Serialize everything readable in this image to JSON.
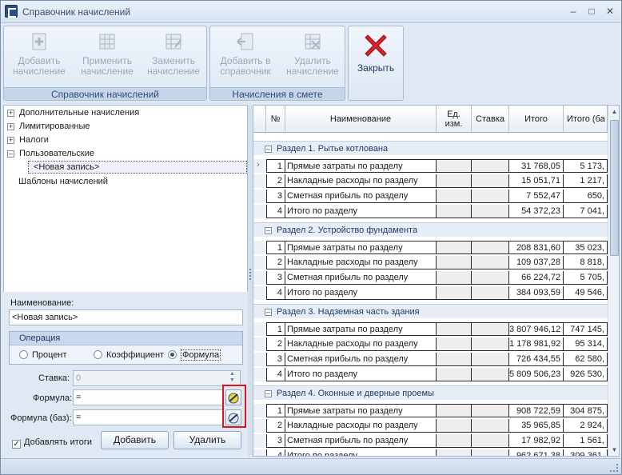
{
  "window": {
    "title": "Справочник начислений"
  },
  "ribbon": {
    "group1": {
      "caption": "Справочник начислений",
      "buttons": [
        {
          "line1": "Добавить",
          "line2": "начисление",
          "icon": "add-document-icon"
        },
        {
          "line1": "Применить",
          "line2": "начисление",
          "icon": "apply-document-icon"
        },
        {
          "line1": "Заменить",
          "line2": "начисление",
          "icon": "replace-document-icon"
        }
      ]
    },
    "group2": {
      "caption": "Начисления в смете",
      "buttons": [
        {
          "line1": "Добавить в",
          "line2": "справочник",
          "icon": "add-to-catalog-icon"
        },
        {
          "line1": "Удалить",
          "line2": "начисление",
          "icon": "delete-document-icon"
        }
      ]
    },
    "close": {
      "label": "Закрыть",
      "icon": "close-x-icon"
    }
  },
  "tree": {
    "items": [
      "Дополнительные начисления",
      "Лимитированные",
      "Налоги",
      "Пользовательские"
    ],
    "selected": "<Новая запись>",
    "plain": "Шаблоны начислений"
  },
  "form": {
    "name_label": "Наименование:",
    "name_value": "<Новая запись>",
    "operation_label": "Операция",
    "radios": [
      "Процент",
      "Коэффициент",
      "Формула"
    ],
    "rate_label": "Ставка:",
    "rate_value": "0",
    "formula_label": "Формула:",
    "formula_value": "=",
    "formula_base_label": "Формула (баз):",
    "formula_base_value": "=",
    "add_totals_label": "Добавлять итоги",
    "add_button": "Добавить",
    "delete_button": "Удалить"
  },
  "grid": {
    "headers": {
      "num": "№",
      "name": "Наименование",
      "unit1": "Ед.",
      "unit2": "изм.",
      "rate": "Ставка",
      "total": "Итого",
      "total_base": "Итого (ба"
    },
    "sections": [
      {
        "label": "Раздел   1. Рытье котлована",
        "rows": [
          {
            "n": "1",
            "name": "Прямые затраты по разделу",
            "total": "31 768,05",
            "base": "5 173,"
          },
          {
            "n": "2",
            "name": "Накладные расходы по разделу",
            "total": "15 051,71",
            "base": "1 217,"
          },
          {
            "n": "3",
            "name": "Сметная прибыль по разделу",
            "total": "7 552,47",
            "base": "650,"
          },
          {
            "n": "4",
            "name": "Итого по разделу",
            "total": "54 372,23",
            "base": "7 041,"
          }
        ]
      },
      {
        "label": "Раздел   2. Устройство фундамента",
        "rows": [
          {
            "n": "1",
            "name": "Прямые затраты по разделу",
            "total": "208 831,60",
            "base": "35 023,"
          },
          {
            "n": "2",
            "name": "Накладные расходы по разделу",
            "total": "109 037,28",
            "base": "8 818,"
          },
          {
            "n": "3",
            "name": "Сметная прибыль по разделу",
            "total": "66 224,72",
            "base": "5 705,"
          },
          {
            "n": "4",
            "name": "Итого по разделу",
            "total": "384 093,59",
            "base": "49 546,"
          }
        ]
      },
      {
        "label": "Раздел   3. Надземная часть здания",
        "rows": [
          {
            "n": "1",
            "name": "Прямые затраты по разделу",
            "total": "3 807 946,12",
            "base": "747 145,"
          },
          {
            "n": "2",
            "name": "Накладные расходы по разделу",
            "total": "1 178 981,92",
            "base": "95 314,"
          },
          {
            "n": "3",
            "name": "Сметная прибыль по разделу",
            "total": "726 434,55",
            "base": "62 580,"
          },
          {
            "n": "4",
            "name": "Итого по разделу",
            "total": "5 809 506,23",
            "base": "926 530,"
          }
        ]
      },
      {
        "label": "Раздел   4. Оконные и дверные проемы",
        "rows": [
          {
            "n": "1",
            "name": "Прямые затраты по разделу",
            "total": "908 722,59",
            "base": "304 875,"
          },
          {
            "n": "2",
            "name": "Накладные расходы по разделу",
            "total": "35 965,85",
            "base": "2 924,"
          },
          {
            "n": "3",
            "name": "Сметная прибыль по разделу",
            "total": "17 982,92",
            "base": "1 561,"
          },
          {
            "n": "4",
            "name": "Итого по разделу",
            "total": "962 671,38",
            "base": "309 361,"
          }
        ]
      }
    ]
  }
}
